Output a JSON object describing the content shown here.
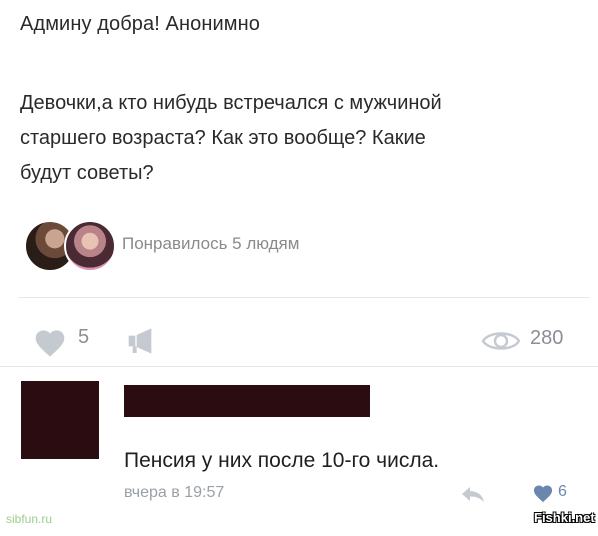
{
  "post": {
    "header": "Админу добра! Анонимно",
    "body_lines": [
      "Девочки,а кто нибудь встречался с мужчиной",
      "старшего возраста? Как это вообще? Какие",
      "будут советы?"
    ],
    "likers_text": "Понравилось 5 людям"
  },
  "actions": {
    "likes": "5",
    "views": "280",
    "icons": {
      "like": "heart-icon",
      "share": "megaphone-icon",
      "views": "eye-icon"
    }
  },
  "comment": {
    "text": "Пенсия у них после 10-го числа.",
    "time": "вчера в 19:57",
    "likes": "6",
    "redaction_color": "#2b0c10",
    "icons": {
      "reply": "reply-arrow-icon",
      "like": "heart-icon"
    }
  },
  "watermarks": {
    "left": "sibfun.ru",
    "right": "Fishki.net"
  },
  "colors": {
    "icon_gray": "#c5cad1",
    "like_blue": "#6b87ad"
  }
}
